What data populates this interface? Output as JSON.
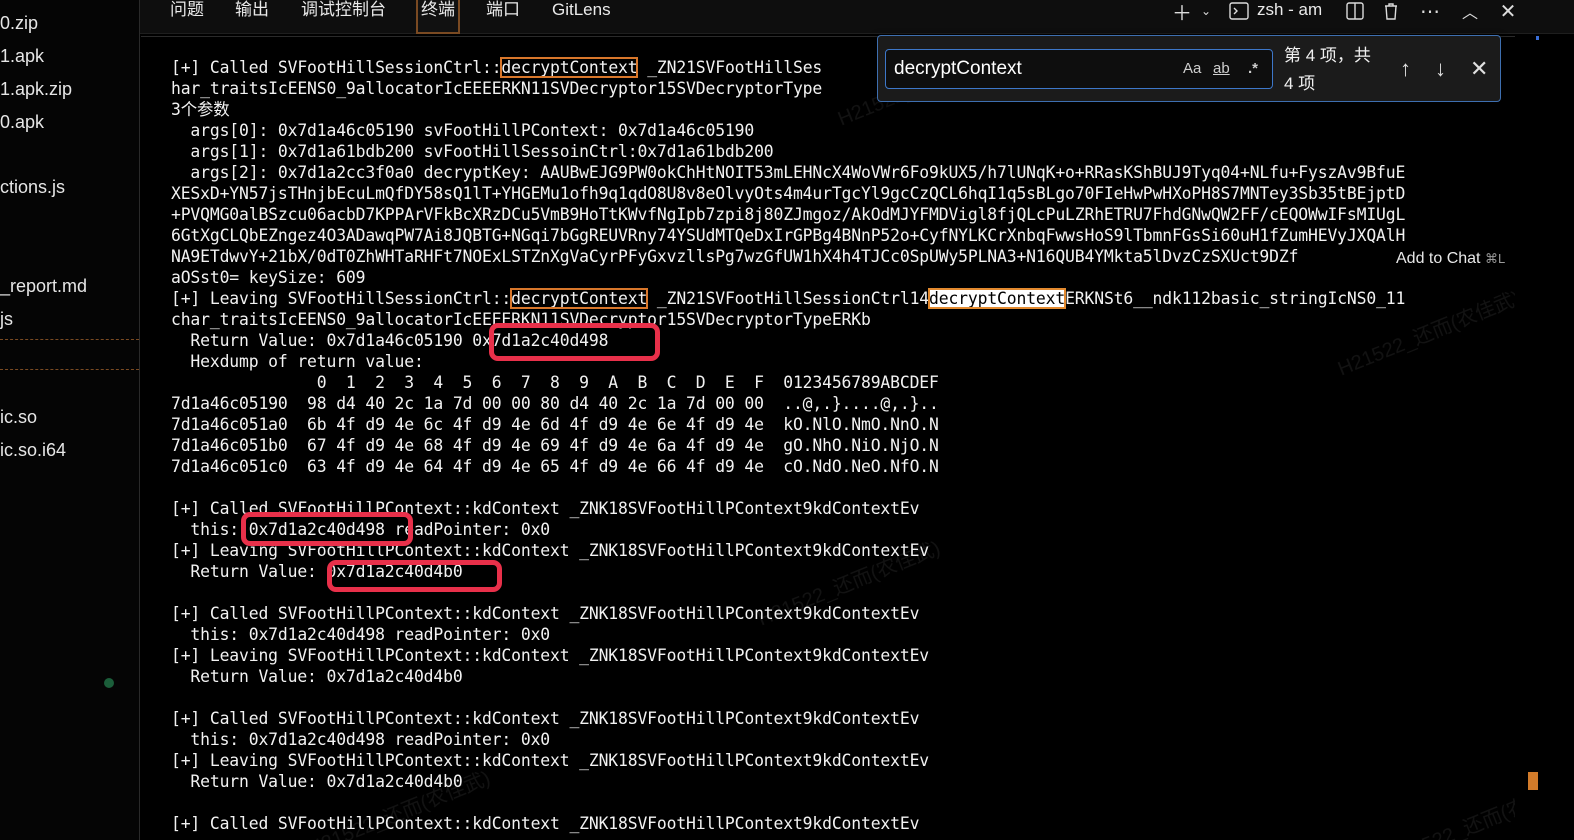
{
  "explorer": {
    "files": [
      "0.zip",
      "1.apk",
      "1.apk.zip",
      "0.apk",
      "ctions.js",
      "_report.md",
      "js",
      "ic.so",
      "ic.so.i64"
    ]
  },
  "tabs": [
    "问题",
    "输出",
    "调试控制台",
    "终端",
    "端口",
    "GitLens"
  ],
  "active_tab": "终端",
  "terminal_selector": "zsh - am",
  "find": {
    "value": "decryptContext",
    "case_label": "Aa",
    "word_label": "ab",
    "regex_label": ".*",
    "count_line1": "第 4 项，共",
    "count_line2": "4 项"
  },
  "add_to_chat": {
    "label": "Add to Chat",
    "shortcut": "⌘L"
  },
  "terminal_lines": [
    "[+] Called SVFootHillSessionCtrl::decryptContext _ZN21SVFootHillSes",
    "har_traitsIcEENS0_9allocatorIcEEEERKN11SVDecryptor15SVDecryptorType",
    "3个参数",
    "  args[0]: 0x7d1a46c05190 svFootHillPContext: 0x7d1a46c05190",
    "  args[1]: 0x7d1a61bdb200 svFootHillSessoinCtrl:0x7d1a61bdb200",
    "  args[2]: 0x7d1a2cc3f0a0 decryptKey: AAUBwEJG9PW0okChHtNOIT53mLEHNcX4WoVWr6Fo9kUX5/h7lUNqK+o+RRasKShBUJ9Tyq04+NLfu+FyszAv9BfuE",
    "XESxD+YN57jsTHnjbEcuLmQfDY58sQ1lT+YHGEMu1ofh9q1qdO8U8v8eOlvyOts4m4urTgcYl9gcCzQCL6hqI1q5sBLgo70FIeHwPwHXoPH8S7MNTey3Sb35tBEjptD",
    "+PVQMG0alBSzcu06acbD7KPPArVFkBcXRzDCu5VmB9HoTtKWvfNgIpb7zpi8j80ZJmgoz/AkOdMJYFMDVigl8fjQLcPuLZRhETRU7FhdGNwQW2FF/cEQOWwIFsMIUgL",
    "6GtXgCLQbEZngez4O3ADawqPW7Ai8JQBTG+NGqi7bGgREUVRny74YSUdMTQeDxIrGPBg4BNnP52o+CyfNYLKCrXnbqFwwsHoS9lTbmnFGsSi60uH1fZumHEVyJXQAlH",
    "NA9ETdwvY+21bX/0dT0ZhWHTaRHFt7NOExLSTZnXgVaCyrPFyGxvzllsPg7wzGfUW1hX4h4TJCc0SpUWy5PLNA3+N16QUB4YMkta5lDvzCzSXUct9DZf",
    "aOSst0= keySize: 609",
    "[+] Leaving SVFootHillSessionCtrl::decryptContext _ZN21SVFootHillSessionCtrl14decryptContextERKNSt6__ndk112basic_stringIcNS0_11",
    "char_traitsIcEENS0_9allocatorIcEEEERKN11SVDecryptor15SVDecryptorTypeERKb",
    "  Return Value: 0x7d1a46c05190 0x7d1a2c40d498",
    "  Hexdump of return value:",
    "               0  1  2  3  4  5  6  7  8  9  A  B  C  D  E  F  0123456789ABCDEF",
    "7d1a46c05190  98 d4 40 2c 1a 7d 00 00 80 d4 40 2c 1a 7d 00 00  ..@,.}....@,.}..",
    "7d1a46c051a0  6b 4f d9 4e 6c 4f d9 4e 6d 4f d9 4e 6e 4f d9 4e  kO.NlO.NmO.NnO.N",
    "7d1a46c051b0  67 4f d9 4e 68 4f d9 4e 69 4f d9 4e 6a 4f d9 4e  gO.NhO.NiO.NjO.N",
    "7d1a46c051c0  63 4f d9 4e 64 4f d9 4e 65 4f d9 4e 66 4f d9 4e  cO.NdO.NeO.NfO.N",
    "",
    "[+] Called SVFootHillPContext::kdContext _ZNK18SVFootHillPContext9kdContextEv",
    "  this: 0x7d1a2c40d498 readPointer: 0x0",
    "[+] Leaving SVFootHillPContext::kdContext _ZNK18SVFootHillPContext9kdContextEv",
    "  Return Value: 0x7d1a2c40d4b0",
    "",
    "[+] Called SVFootHillPContext::kdContext _ZNK18SVFootHillPContext9kdContextEv",
    "  this: 0x7d1a2c40d498 readPointer: 0x0",
    "[+] Leaving SVFootHillPContext::kdContext _ZNK18SVFootHillPContext9kdContextEv",
    "  Return Value: 0x7d1a2c40d4b0",
    "",
    "[+] Called SVFootHillPContext::kdContext _ZNK18SVFootHillPContext9kdContextEv",
    "  this: 0x7d1a2c40d498 readPointer: 0x0",
    "[+] Leaving SVFootHillPContext::kdContext _ZNK18SVFootHillPContext9kdContextEv",
    "  Return Value: 0x7d1a2c40d4b0",
    "",
    "[+] Called SVFootHillPContext::kdContext _ZNK18SVFootHillPContext9kdContextEv"
  ],
  "colors": {
    "highlight": "#d9772b",
    "current_match": "#ffffff",
    "annotation_red": "#e8304a",
    "find_border": "#3d77c9"
  }
}
